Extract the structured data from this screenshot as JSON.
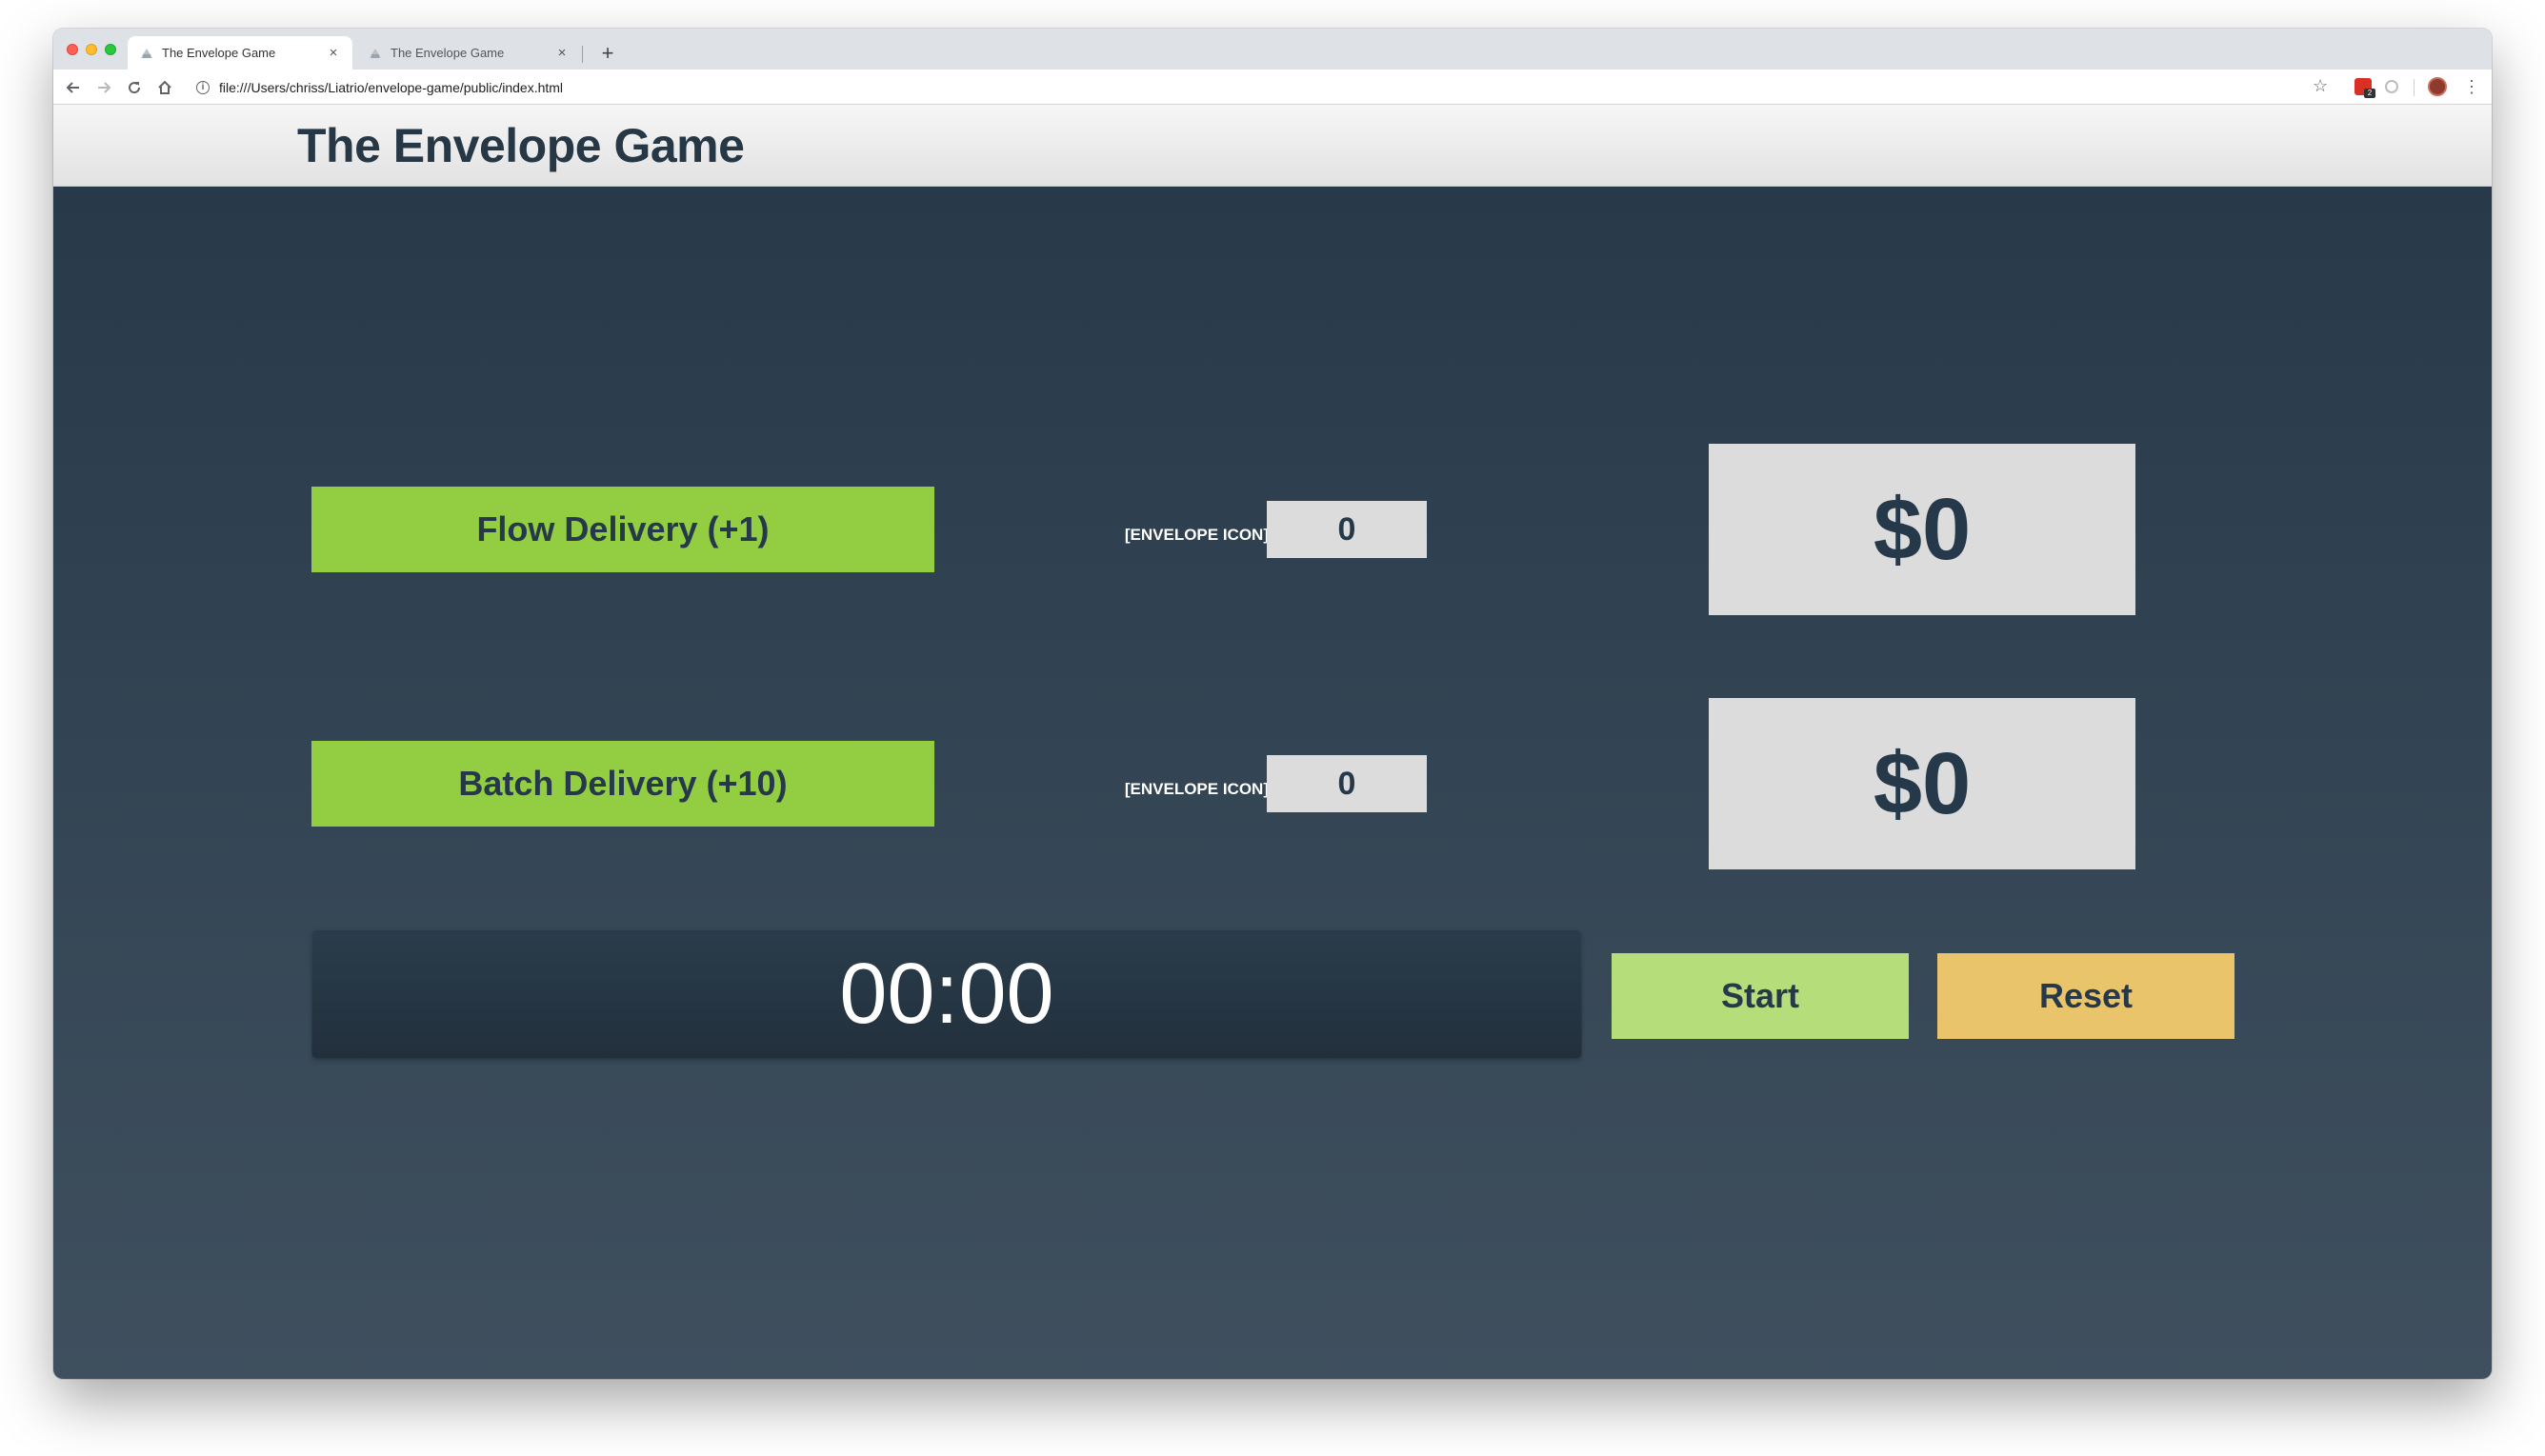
{
  "browser": {
    "tabs": [
      {
        "title": "The Envelope Game",
        "active": true
      },
      {
        "title": "The Envelope Game",
        "active": false
      }
    ],
    "new_tab_label": "+",
    "close_glyph": "×",
    "url": "file:///Users/chriss/Liatrio/envelope-game/public/index.html",
    "extension_badge": "2"
  },
  "app": {
    "title": "The Envelope Game",
    "flow_button_label": "Flow Delivery (+1)",
    "batch_button_label": "Batch Delivery (+10)",
    "envelope_icon_label": "[ENVELOPE ICON]",
    "flow_envelope_count": "0",
    "batch_envelope_count": "0",
    "flow_money": "$0",
    "batch_money": "$0",
    "timer": "00:00",
    "start_label": "Start",
    "reset_label": "Reset"
  },
  "colors": {
    "delivery_button": "#92cd42",
    "start_button": "#b5de7b",
    "reset_button": "#e9c46a",
    "stage_top": "#283a4a",
    "stage_bottom": "#3f4f5e",
    "text_dark": "#26394a"
  },
  "icons": [
    "favicon-icon",
    "close-icon",
    "back-arrow-icon",
    "forward-arrow-icon",
    "reload-icon",
    "home-icon",
    "info-icon",
    "star-icon",
    "extension-icon",
    "profile-avatar",
    "menu-icon"
  ]
}
